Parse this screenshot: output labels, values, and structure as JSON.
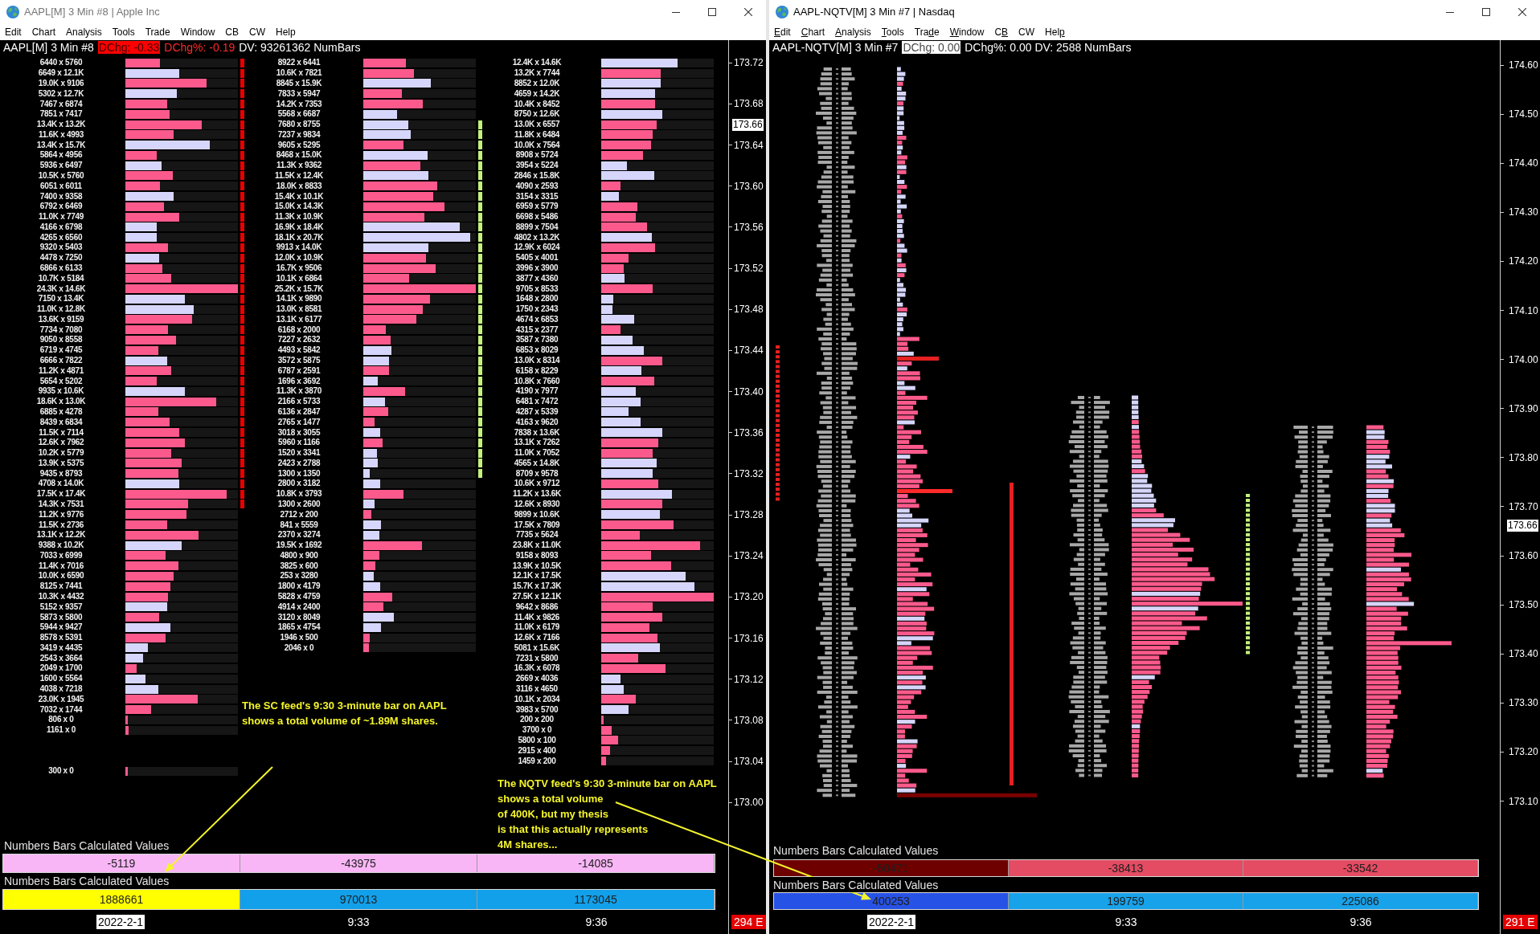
{
  "windows": [
    {
      "title": "AAPL[M] 3 Min #8 | Apple Inc",
      "active": false,
      "menu": [
        "Edit",
        "Chart",
        "Analysis",
        "Tools",
        "Trade",
        "Window",
        "CB",
        "CW",
        "Help"
      ],
      "header": [
        {
          "text": "AAPL[M] 3 Min #8",
          "kind": "plain"
        },
        {
          "text": "DChg: -0.33",
          "kind": "box",
          "color": "#ff0000"
        },
        {
          "text": "DChg%: -0.19",
          "kind": "colored",
          "color": "#ff2a2a"
        },
        {
          "text": "DV: 93261362 NumBars",
          "kind": "plain"
        }
      ],
      "columns": [
        {
          "color": "#e80000",
          "rows": [
            {
              "kind": "bar",
              "text": "6440 x 5760",
              "color": "#fc5a8c",
              "level": 0.31,
              "marked": true
            },
            {
              "kind": "bar",
              "text": "6649 x 12.1K",
              "color": "#d6d6fc",
              "level": 0.48,
              "marked": true
            },
            {
              "kind": "bar",
              "text": "19.0K x 9106",
              "color": "#fc5a8c",
              "level": 0.72,
              "marked": true
            },
            {
              "kind": "bar",
              "text": "5302 x 12.7K",
              "color": "#d6d6fc",
              "level": 0.46,
              "marked": true
            },
            {
              "kind": "bar",
              "text": "7467 x 6874",
              "color": "#fc5a8c",
              "level": 0.37,
              "marked": true
            },
            {
              "kind": "bar",
              "text": "7851 x 7417",
              "color": "#fc5a8c",
              "level": 0.39,
              "marked": true
            },
            {
              "kind": "bar",
              "text": "13.4K x 13.2K",
              "color": "#fc5a8c",
              "level": 0.68,
              "marked": true
            },
            {
              "kind": "bar",
              "text": "11.6K x 4993",
              "color": "#fc5a8c",
              "level": 0.43,
              "marked": true
            },
            {
              "kind": "bar",
              "text": "13.4K x 15.7K",
              "color": "#d6d6fc",
              "level": 0.75,
              "marked": true
            },
            {
              "kind": "bar",
              "text": "5864 x 4956",
              "color": "#fc5a8c",
              "level": 0.28,
              "marked": true
            },
            {
              "kind": "bar",
              "text": "5936 x 6497",
              "color": "#d6d6fc",
              "level": 0.32,
              "marked": true
            },
            {
              "kind": "bar",
              "text": "10.5K x 5760",
              "color": "#fc5a8c",
              "level": 0.42,
              "marked": true
            },
            {
              "kind": "bar",
              "text": "6051 x 6011",
              "color": "#fc5a8c",
              "level": 0.31,
              "marked": true
            },
            {
              "kind": "bar",
              "text": "7400 x 9358",
              "color": "#d6d6fc",
              "level": 0.43,
              "marked": true
            },
            {
              "kind": "bar",
              "text": "6792 x 6469",
              "color": "#fc5a8c",
              "level": 0.34,
              "marked": true
            },
            {
              "kind": "bar",
              "text": "11.0K x 7749",
              "color": "#fc5a8c",
              "level": 0.48,
              "marked": true
            },
            {
              "kind": "bar",
              "text": "4166 x 6798",
              "color": "#d6d6fc",
              "level": 0.28,
              "marked": true
            },
            {
              "kind": "bar",
              "text": "4265 x 6560",
              "color": "#d6d6fc",
              "level": 0.28,
              "marked": true
            },
            {
              "kind": "bar",
              "text": "9320 x 5403",
              "color": "#fc5a8c",
              "level": 0.38,
              "marked": true
            },
            {
              "kind": "bar",
              "text": "4478 x 7250",
              "color": "#d6d6fc",
              "level": 0.3,
              "marked": true
            },
            {
              "kind": "bar",
              "text": "6866 x 6133",
              "color": "#fc5a8c",
              "level": 0.33,
              "marked": true
            },
            {
              "kind": "bar",
              "text": "10.7K x 5184",
              "color": "#fc5a8c",
              "level": 0.41,
              "marked": true
            },
            {
              "kind": "bar",
              "text": "24.3K x 14.6K",
              "color": "#fc5a8c",
              "level": 1.0,
              "marked": true
            },
            {
              "kind": "bar",
              "text": "7150 x 13.4K",
              "color": "#d6d6fc",
              "level": 0.53,
              "marked": true
            },
            {
              "kind": "bar",
              "text": "11.0K x 12.8K",
              "color": "#d6d6fc",
              "level": 0.61,
              "marked": true
            },
            {
              "kind": "bar",
              "text": "13.6K x 9159",
              "color": "#fc5a8c",
              "level": 0.59,
              "marked": true
            },
            {
              "kind": "bar",
              "text": "7734 x 7080",
              "color": "#fc5a8c",
              "level": 0.38,
              "marked": true
            },
            {
              "kind": "bar",
              "text": "9050 x 8558",
              "color": "#fc5a8c",
              "level": 0.45,
              "marked": true
            },
            {
              "kind": "bar",
              "text": "6719 x 4745",
              "color": "#fc5a8c",
              "level": 0.29,
              "marked": true
            },
            {
              "kind": "bar",
              "text": "6666 x 7822",
              "color": "#d6d6fc",
              "level": 0.37,
              "marked": true
            },
            {
              "kind": "bar",
              "text": "11.2K x 4871",
              "color": "#fc5a8c",
              "level": 0.41,
              "marked": true
            },
            {
              "kind": "bar",
              "text": "5654 x 5202",
              "color": "#fc5a8c",
              "level": 0.28,
              "marked": true
            },
            {
              "kind": "bar",
              "text": "9935 x 10.6K",
              "color": "#d6d6fc",
              "level": 0.53,
              "marked": true
            },
            {
              "kind": "bar",
              "text": "18.6K x 13.0K",
              "color": "#fc5a8c",
              "level": 0.81,
              "marked": true
            },
            {
              "kind": "bar",
              "text": "6885 x 4278",
              "color": "#fc5a8c",
              "level": 0.29,
              "marked": true
            },
            {
              "kind": "bar",
              "text": "8439 x 6834",
              "color": "#fc5a8c",
              "level": 0.39,
              "marked": true
            },
            {
              "kind": "bar",
              "text": "11.5K x 7114",
              "color": "#fc5a8c",
              "level": 0.48,
              "marked": true
            },
            {
              "kind": "bar",
              "text": "12.6K x 7962",
              "color": "#fc5a8c",
              "level": 0.53,
              "marked": true
            },
            {
              "kind": "bar",
              "text": "10.2K x 5779",
              "color": "#fc5a8c",
              "level": 0.41,
              "marked": true
            },
            {
              "kind": "bar",
              "text": "13.9K x 5375",
              "color": "#fc5a8c",
              "level": 0.5,
              "marked": true
            },
            {
              "kind": "bar",
              "text": "9435 x 8793",
              "color": "#fc5a8c",
              "level": 0.47,
              "marked": true
            },
            {
              "kind": "bar",
              "text": "4708 x 14.0K",
              "color": "#d6d6fc",
              "level": 0.48,
              "marked": true
            },
            {
              "kind": "bar",
              "text": "17.5K x 17.4K",
              "color": "#fc5a8c",
              "level": 0.9,
              "marked": true
            },
            {
              "kind": "bar",
              "text": "14.3K x 7531",
              "color": "#fc5a8c",
              "level": 0.56,
              "marked": true
            },
            {
              "kind": "bar",
              "text": "11.2K x 9776",
              "color": "#fc5a8c",
              "level": 0.54,
              "marked": false
            },
            {
              "kind": "bar",
              "text": "11.5K x 2736",
              "color": "#fc5a8c",
              "level": 0.37,
              "marked": false
            },
            {
              "kind": "bar",
              "text": "13.1K x 12.2K",
              "color": "#fc5a8c",
              "level": 0.65,
              "marked": false
            },
            {
              "kind": "bar",
              "text": "9388 x 10.2K",
              "color": "#d6d6fc",
              "level": 0.5,
              "marked": false
            },
            {
              "kind": "bar",
              "text": "7033 x 6999",
              "color": "#fc5a8c",
              "level": 0.36,
              "marked": false
            },
            {
              "kind": "bar",
              "text": "11.4K x 7016",
              "color": "#fc5a8c",
              "level": 0.47,
              "marked": false
            },
            {
              "kind": "bar",
              "text": "10.0K x 6590",
              "color": "#fc5a8c",
              "level": 0.43,
              "marked": false
            },
            {
              "kind": "bar",
              "text": "8125 x 7441",
              "color": "#fc5a8c",
              "level": 0.4,
              "marked": false
            },
            {
              "kind": "bar",
              "text": "10.3K x 4432",
              "color": "#fc5a8c",
              "level": 0.38,
              "marked": false
            },
            {
              "kind": "bar",
              "text": "5152 x 9357",
              "color": "#d6d6fc",
              "level": 0.37,
              "marked": false
            },
            {
              "kind": "bar",
              "text": "5873 x 5800",
              "color": "#fc5a8c",
              "level": 0.3,
              "marked": false
            },
            {
              "kind": "bar",
              "text": "5944 x 9427",
              "color": "#d6d6fc",
              "level": 0.4,
              "marked": false
            },
            {
              "kind": "bar",
              "text": "8578 x 5391",
              "color": "#fc5a8c",
              "level": 0.36,
              "marked": false
            },
            {
              "kind": "bar",
              "text": "3419 x 4435",
              "color": "#d6d6fc",
              "level": 0.2,
              "marked": false
            },
            {
              "kind": "bar",
              "text": "2543 x 3664",
              "color": "#d6d6fc",
              "level": 0.16,
              "marked": false
            },
            {
              "kind": "bar",
              "text": "2049 x 1700",
              "color": "#fc5a8c",
              "level": 0.1,
              "marked": false
            },
            {
              "kind": "bar",
              "text": "1600 x 5564",
              "color": "#d6d6fc",
              "level": 0.18,
              "marked": false
            },
            {
              "kind": "bar",
              "text": "4038 x 7218",
              "color": "#d6d6fc",
              "level": 0.29,
              "marked": false
            },
            {
              "kind": "bar",
              "text": "23.0K x 1945",
              "color": "#fc5a8c",
              "level": 0.64,
              "marked": false
            },
            {
              "kind": "bar",
              "text": "7032 x 1744",
              "color": "#fc5a8c",
              "level": 0.23,
              "marked": false
            },
            {
              "kind": "bar",
              "text": "806 x 0",
              "color": "#fc5a8c",
              "level": 0.02,
              "marked": false
            },
            {
              "kind": "bar",
              "text": "1161 x 0",
              "color": "#fc5a8c",
              "level": 0.03,
              "marked": false
            },
            {
              "kind": "empty"
            },
            {
              "kind": "empty"
            },
            {
              "kind": "empty"
            },
            {
              "kind": "bar",
              "text": "300 x 0",
              "color": "#fc5a8c",
              "level": 0.02,
              "marked": false
            }
          ]
        },
        {
          "color": "#c4f27c",
          "rows": [
            {
              "text": "8922 x 6441",
              "color": "#fc5a8c",
              "level": 0.38,
              "marked": false
            },
            {
              "text": "10.6K x 7821",
              "color": "#fc5a8c",
              "level": 0.45,
              "marked": false
            },
            {
              "text": "8845 x 15.9K",
              "color": "#d6d6fc",
              "level": 0.6,
              "marked": false
            },
            {
              "text": "7833 x 5947",
              "color": "#fc5a8c",
              "level": 0.34,
              "marked": false
            },
            {
              "text": "14.2K x 7353",
              "color": "#fc5a8c",
              "level": 0.53,
              "marked": false
            },
            {
              "text": "5568 x 6687",
              "color": "#d6d6fc",
              "level": 0.3,
              "marked": false
            },
            {
              "text": "7680 x 8755",
              "color": "#d6d6fc",
              "level": 0.4,
              "marked": true
            },
            {
              "text": "7237 x 9834",
              "color": "#d6d6fc",
              "level": 0.42,
              "marked": true
            },
            {
              "text": "9605 x 5295",
              "color": "#fc5a8c",
              "level": 0.36,
              "marked": true
            },
            {
              "text": "8468 x 15.0K",
              "color": "#d6d6fc",
              "level": 0.57,
              "marked": true
            },
            {
              "text": "11.3K x 9362",
              "color": "#fc5a8c",
              "level": 0.51,
              "marked": true
            },
            {
              "text": "11.5K x 12.4K",
              "color": "#d6d6fc",
              "level": 0.58,
              "marked": true
            },
            {
              "text": "18.0K x 8833",
              "color": "#fc5a8c",
              "level": 0.66,
              "marked": true
            },
            {
              "text": "15.4K x 10.1K",
              "color": "#fc5a8c",
              "level": 0.62,
              "marked": true
            },
            {
              "text": "15.0K x 14.3K",
              "color": "#fc5a8c",
              "level": 0.72,
              "marked": true
            },
            {
              "text": "11.3K x 10.9K",
              "color": "#fc5a8c",
              "level": 0.54,
              "marked": true
            },
            {
              "text": "16.9K x 18.4K",
              "color": "#d6d6fc",
              "level": 0.86,
              "marked": true
            },
            {
              "text": "18.1K x 20.7K",
              "color": "#d6d6fc",
              "level": 0.95,
              "marked": true
            },
            {
              "text": "9913 x 14.0K",
              "color": "#d6d6fc",
              "level": 0.58,
              "marked": true
            },
            {
              "text": "12.0K x 10.9K",
              "color": "#fc5a8c",
              "level": 0.56,
              "marked": true
            },
            {
              "text": "16.7K x 9506",
              "color": "#fc5a8c",
              "level": 0.64,
              "marked": true
            },
            {
              "text": "10.1K x 6864",
              "color": "#fc5a8c",
              "level": 0.41,
              "marked": true
            },
            {
              "text": "25.2K x 15.7K",
              "color": "#fc5a8c",
              "level": 1.0,
              "marked": true
            },
            {
              "text": "14.1K x 9890",
              "color": "#fc5a8c",
              "level": 0.59,
              "marked": true
            },
            {
              "text": "13.0K x 8581",
              "color": "#fc5a8c",
              "level": 0.53,
              "marked": true
            },
            {
              "text": "13.1K x 6177",
              "color": "#fc5a8c",
              "level": 0.47,
              "marked": true
            },
            {
              "text": "6168 x 2000",
              "color": "#fc5a8c",
              "level": 0.2,
              "marked": true
            },
            {
              "text": "7227 x 2632",
              "color": "#fc5a8c",
              "level": 0.24,
              "marked": true
            },
            {
              "text": "4493 x 5842",
              "color": "#d6d6fc",
              "level": 0.25,
              "marked": true
            },
            {
              "text": "3572 x 5875",
              "color": "#d6d6fc",
              "level": 0.23,
              "marked": true
            },
            {
              "text": "6787 x 2591",
              "color": "#fc5a8c",
              "level": 0.23,
              "marked": true
            },
            {
              "text": "1696 x 3692",
              "color": "#d6d6fc",
              "level": 0.13,
              "marked": true
            },
            {
              "text": "11.3K x 3870",
              "color": "#fc5a8c",
              "level": 0.37,
              "marked": true
            },
            {
              "text": "2166 x 5733",
              "color": "#d6d6fc",
              "level": 0.19,
              "marked": true
            },
            {
              "text": "6136 x 2847",
              "color": "#fc5a8c",
              "level": 0.22,
              "marked": true
            },
            {
              "text": "2765 x 1477",
              "color": "#fc5a8c",
              "level": 0.1,
              "marked": true
            },
            {
              "text": "3018 x 3055",
              "color": "#d6d6fc",
              "level": 0.15,
              "marked": true
            },
            {
              "text": "5960 x 1166",
              "color": "#fc5a8c",
              "level": 0.17,
              "marked": true
            },
            {
              "text": "1520 x 3341",
              "color": "#d6d6fc",
              "level": 0.12,
              "marked": true
            },
            {
              "text": "2423 x 2788",
              "color": "#d6d6fc",
              "level": 0.13,
              "marked": true
            },
            {
              "text": "1300 x 1350",
              "color": "#d6d6fc",
              "level": 0.06,
              "marked": true
            },
            {
              "text": "2800 x 3182",
              "color": "#d6d6fc",
              "level": 0.15,
              "marked": false
            },
            {
              "text": "10.8K x 3793",
              "color": "#fc5a8c",
              "level": 0.36,
              "marked": false
            },
            {
              "text": "1300 x 2600",
              "color": "#d6d6fc",
              "level": 0.1,
              "marked": false
            },
            {
              "text": "2712 x 200",
              "color": "#fc5a8c",
              "level": 0.07,
              "marked": false
            },
            {
              "text": "841 x 5559",
              "color": "#d6d6fc",
              "level": 0.16,
              "marked": false
            },
            {
              "text": "2370 x 3274",
              "color": "#d6d6fc",
              "level": 0.14,
              "marked": false
            },
            {
              "text": "19.5K x 1692",
              "color": "#fc5a8c",
              "level": 0.52,
              "marked": false
            },
            {
              "text": "4800 x 900",
              "color": "#fc5a8c",
              "level": 0.14,
              "marked": false
            },
            {
              "text": "3825 x 600",
              "color": "#fc5a8c",
              "level": 0.11,
              "marked": false
            },
            {
              "text": "253 x 3280",
              "color": "#d6d6fc",
              "level": 0.09,
              "marked": false
            },
            {
              "text": "1800 x 4179",
              "color": "#d6d6fc",
              "level": 0.15,
              "marked": false
            },
            {
              "text": "5828 x 4759",
              "color": "#fc5a8c",
              "level": 0.26,
              "marked": false
            },
            {
              "text": "4914 x 2400",
              "color": "#fc5a8c",
              "level": 0.18,
              "marked": false
            },
            {
              "text": "3120 x 8049",
              "color": "#d6d6fc",
              "level": 0.27,
              "marked": false
            },
            {
              "text": "1865 x 4754",
              "color": "#d6d6fc",
              "level": 0.16,
              "marked": false
            },
            {
              "text": "1946 x 500",
              "color": "#fc5a8c",
              "level": 0.06,
              "marked": false
            },
            {
              "text": "2046 x 0",
              "color": "#fc5a8c",
              "level": 0.05,
              "marked": false
            }
          ]
        },
        {
          "rows": [
            {
              "text": "12.4K x 14.6K",
              "color": "#d6d6fc",
              "level": 0.68
            },
            {
              "text": "13.2K x 7744",
              "color": "#fc5a8c",
              "level": 0.53
            },
            {
              "text": "8852 x 12.0K",
              "color": "#d6d6fc",
              "level": 0.53
            },
            {
              "text": "4659 x 14.2K",
              "color": "#d6d6fc",
              "level": 0.48
            },
            {
              "text": "10.4K x 8452",
              "color": "#fc5a8c",
              "level": 0.48
            },
            {
              "text": "8750 x 12.6K",
              "color": "#d6d6fc",
              "level": 0.54
            },
            {
              "text": "13.0K x 6557",
              "color": "#fc5a8c",
              "level": 0.49
            },
            {
              "text": "11.8K x 6484",
              "color": "#fc5a8c",
              "level": 0.46
            },
            {
              "text": "10.0K x 7564",
              "color": "#fc5a8c",
              "level": 0.44
            },
            {
              "text": "8908 x 5724",
              "color": "#fc5a8c",
              "level": 0.37
            },
            {
              "text": "3954 x 5224",
              "color": "#d6d6fc",
              "level": 0.23
            },
            {
              "text": "2846 x 15.8K",
              "color": "#d6d6fc",
              "level": 0.47
            },
            {
              "text": "4090 x 2593",
              "color": "#fc5a8c",
              "level": 0.17
            },
            {
              "text": "3154 x 3315",
              "color": "#d6d6fc",
              "level": 0.16
            },
            {
              "text": "6959 x 5779",
              "color": "#fc5a8c",
              "level": 0.32
            },
            {
              "text": "6698 x 5486",
              "color": "#fc5a8c",
              "level": 0.31
            },
            {
              "text": "8899 x 7504",
              "color": "#fc5a8c",
              "level": 0.41
            },
            {
              "text": "4802 x 13.2K",
              "color": "#d6d6fc",
              "level": 0.45
            },
            {
              "text": "12.9K x 6024",
              "color": "#fc5a8c",
              "level": 0.48
            },
            {
              "text": "5405 x 4001",
              "color": "#fc5a8c",
              "level": 0.24
            },
            {
              "text": "3996 x 3900",
              "color": "#fc5a8c",
              "level": 0.2
            },
            {
              "text": "3877 x 4360",
              "color": "#d6d6fc",
              "level": 0.21
            },
            {
              "text": "9705 x 8533",
              "color": "#fc5a8c",
              "level": 0.46
            },
            {
              "text": "1648 x 2800",
              "color": "#d6d6fc",
              "level": 0.11
            },
            {
              "text": "1750 x 2343",
              "color": "#d6d6fc",
              "level": 0.1
            },
            {
              "text": "4674 x 6853",
              "color": "#d6d6fc",
              "level": 0.29
            },
            {
              "text": "4315 x 2377",
              "color": "#fc5a8c",
              "level": 0.17
            },
            {
              "text": "3587 x 7380",
              "color": "#d6d6fc",
              "level": 0.28
            },
            {
              "text": "6853 x 8029",
              "color": "#d6d6fc",
              "level": 0.38
            },
            {
              "text": "13.0K x 8314",
              "color": "#fc5a8c",
              "level": 0.54
            },
            {
              "text": "6158 x 8229",
              "color": "#d6d6fc",
              "level": 0.36
            },
            {
              "text": "10.8K x 7660",
              "color": "#fc5a8c",
              "level": 0.47
            },
            {
              "text": "4190 x 7977",
              "color": "#d6d6fc",
              "level": 0.31
            },
            {
              "text": "6481 x 7472",
              "color": "#d6d6fc",
              "level": 0.35
            },
            {
              "text": "4287 x 5339",
              "color": "#d6d6fc",
              "level": 0.24
            },
            {
              "text": "4163 x 9620",
              "color": "#d6d6fc",
              "level": 0.35
            },
            {
              "text": "7838 x 13.6K",
              "color": "#d6d6fc",
              "level": 0.54
            },
            {
              "text": "13.1K x 7262",
              "color": "#fc5a8c",
              "level": 0.51
            },
            {
              "text": "11.0K x 7052",
              "color": "#fc5a8c",
              "level": 0.46
            },
            {
              "text": "4565 x 14.8K",
              "color": "#d6d6fc",
              "level": 0.49
            },
            {
              "text": "8709 x 9578",
              "color": "#d6d6fc",
              "level": 0.46
            },
            {
              "text": "10.6K x 9712",
              "color": "#fc5a8c",
              "level": 0.51
            },
            {
              "text": "11.2K x 13.6K",
              "color": "#d6d6fc",
              "level": 0.63
            },
            {
              "text": "12.6K x 8930",
              "color": "#fc5a8c",
              "level": 0.54
            },
            {
              "text": "9899 x 10.6K",
              "color": "#d6d6fc",
              "level": 0.52
            },
            {
              "text": "17.5K x 7809",
              "color": "#fc5a8c",
              "level": 0.64
            },
            {
              "text": "7735 x 5624",
              "color": "#fc5a8c",
              "level": 0.34
            },
            {
              "text": "23.8K x 11.0K",
              "color": "#fc5a8c",
              "level": 0.88
            },
            {
              "text": "9158 x 8093",
              "color": "#fc5a8c",
              "level": 0.44
            },
            {
              "text": "13.9K x 10.5K",
              "color": "#fc5a8c",
              "level": 0.62
            },
            {
              "text": "12.1K x 17.5K",
              "color": "#d6d6fc",
              "level": 0.75
            },
            {
              "text": "15.7K x 17.3K",
              "color": "#d6d6fc",
              "level": 0.83
            },
            {
              "text": "27.5K x 12.1K",
              "color": "#fc5a8c",
              "level": 1.0
            },
            {
              "text": "9642 x 8686",
              "color": "#fc5a8c",
              "level": 0.46
            },
            {
              "text": "11.4K x 9826",
              "color": "#fc5a8c",
              "level": 0.54
            },
            {
              "text": "11.0K x 6179",
              "color": "#fc5a8c",
              "level": 0.43
            },
            {
              "text": "12.6K x 7166",
              "color": "#fc5a8c",
              "level": 0.5
            },
            {
              "text": "5081 x 15.6K",
              "color": "#d6d6fc",
              "level": 0.52
            },
            {
              "text": "7231 x 5800",
              "color": "#fc5a8c",
              "level": 0.33
            },
            {
              "text": "16.3K x 6078",
              "color": "#fc5a8c",
              "level": 0.57
            },
            {
              "text": "2669 x 4036",
              "color": "#d6d6fc",
              "level": 0.17
            },
            {
              "text": "3116 x 4650",
              "color": "#d6d6fc",
              "level": 0.2
            },
            {
              "text": "10.1K x 2034",
              "color": "#fc5a8c",
              "level": 0.31
            },
            {
              "text": "3983 x 5700",
              "color": "#d6d6fc",
              "level": 0.24
            },
            {
              "text": "200 x 200",
              "color": "#fc5a8c",
              "level": 0.02
            },
            {
              "text": "3700 x 0",
              "color": "#fc5a8c",
              "level": 0.09
            },
            {
              "text": "5800 x 100",
              "color": "#fc5a8c",
              "level": 0.15
            },
            {
              "text": "2915 x 400",
              "color": "#fc5a8c",
              "level": 0.08
            },
            {
              "text": "1459 x 200",
              "color": "#fc5a8c",
              "level": 0.04
            }
          ]
        }
      ],
      "price_axis": {
        "ticks": [
          "173.72",
          "173.68",
          "173.64",
          "173.60",
          "173.56",
          "173.52",
          "173.48",
          "173.44",
          "173.40",
          "173.36",
          "173.32",
          "173.28",
          "173.24",
          "173.20",
          "173.16",
          "173.12",
          "173.08",
          "173.04",
          "173.00"
        ],
        "current": "173.66"
      },
      "panels": [
        {
          "label": "Numbers Bars Calculated Values",
          "cells": [
            {
              "text": "-5119",
              "color": "#f9b6f6"
            },
            {
              "text": "-43975",
              "color": "#f9b6f6"
            },
            {
              "text": "-14085",
              "color": "#f9b6f6"
            }
          ]
        },
        {
          "label": "Numbers Bars Calculated Values",
          "cells": [
            {
              "text": "1888661",
              "color": "#ffff00"
            },
            {
              "text": "970013",
              "color": "#12a0ea"
            },
            {
              "text": "1173045",
              "color": "#12a0ea"
            }
          ]
        }
      ],
      "time_axis": {
        "labels": [
          {
            "text": "2022-2-1",
            "kind": "date"
          },
          {
            "text": "9:33",
            "kind": "time"
          },
          {
            "text": "9:36",
            "kind": "time"
          }
        ],
        "count": "294 E"
      }
    },
    {
      "title": "AAPL-NQTV[M] 3 Min #7 | Nasdaq",
      "active": true,
      "menu": [
        {
          "key": "E",
          "after": "dit"
        },
        {
          "key": "C",
          "after": "hart"
        },
        {
          "key": "A",
          "after": "nalysis"
        },
        {
          "key": "T",
          "after": "ools"
        },
        {
          "before": "Tra",
          "key": "d",
          "after": "e"
        },
        {
          "key": "W",
          "after": "indow"
        },
        {
          "before": "C",
          "key": "B"
        },
        {
          "text": "CW"
        },
        {
          "before": "Hel",
          "key": "p"
        }
      ],
      "header": [
        {
          "text": "AAPL-NQTV[M] 3 Min #7",
          "kind": "plain"
        },
        {
          "text": "DChg: 0.00",
          "kind": "box",
          "color": "#ffffff"
        },
        {
          "text": "DChg%: 0.00 DV: 2588 NumBars",
          "kind": "plain"
        }
      ],
      "price_axis": {
        "ticks": [
          "174.60",
          "174.50",
          "174.40",
          "174.30",
          "174.20",
          "174.10",
          "174.00",
          "173.90",
          "173.80",
          "173.70",
          "173.60",
          "173.50",
          "173.40",
          "173.30",
          "173.20",
          "173.10"
        ],
        "current": "173.66"
      },
      "panels": [
        {
          "label": "Numbers Bars Calculated Values",
          "cells": [
            {
              "text": "-50471",
              "color": "#6e0000"
            },
            {
              "text": "-38413",
              "color": "#e34c63"
            },
            {
              "text": "-33542",
              "color": "#e34c63"
            }
          ]
        },
        {
          "label": "Numbers Bars Calculated Values",
          "cells": [
            {
              "text": "400253",
              "color": "#2752e6"
            },
            {
              "text": "199759",
              "color": "#18a2ea"
            },
            {
              "text": "225086",
              "color": "#18a2ea"
            }
          ]
        }
      ],
      "time_axis": {
        "labels": [
          {
            "text": "2022-2-1",
            "kind": "date"
          },
          {
            "text": "9:33",
            "kind": "time"
          },
          {
            "text": "9:36",
            "kind": "time"
          }
        ],
        "count": "291 E"
      }
    }
  ],
  "annotations": [
    {
      "lines": [
        "The SC feed's 9:30 3-minute bar on AAPL",
        "shows a total volume of ~1.89M shares."
      ]
    },
    {
      "lines": [
        "The NQTV feed's 9:30 3-minute bar on AAPL",
        "shows a total volume",
        "of 400K, but my thesis",
        "is that this actually represents",
        "4M shares..."
      ]
    }
  ]
}
